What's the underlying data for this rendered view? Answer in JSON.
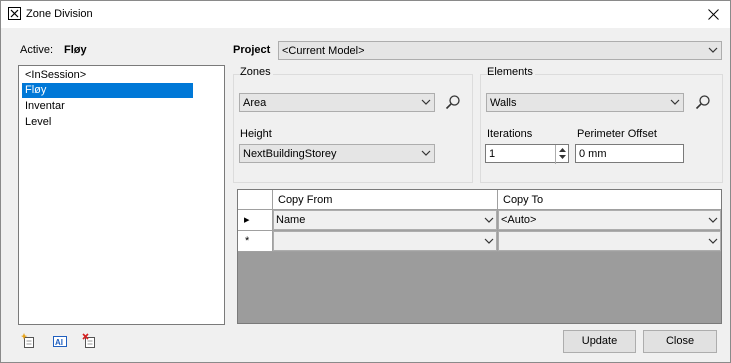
{
  "window": {
    "title": "Zone Division",
    "icon": "zone-division-icon"
  },
  "active": {
    "label": "Active:",
    "value": "Fløy"
  },
  "list": {
    "items": [
      {
        "label": "<InSession>"
      },
      {
        "label": "Fløy",
        "selected": true
      },
      {
        "label": "Inventar"
      },
      {
        "label": "Level"
      }
    ]
  },
  "project": {
    "label": "Project",
    "value": "<Current Model>"
  },
  "zones": {
    "group_label": "Zones",
    "type_value": "Area",
    "height_label": "Height",
    "height_value": "NextBuildingStorey"
  },
  "elements": {
    "group_label": "Elements",
    "type_value": "Walls",
    "iterations_label": "Iterations",
    "iterations_value": "1",
    "perimeter_label": "Perimeter Offset",
    "perimeter_value": "0 mm"
  },
  "grid": {
    "columns": [
      "Copy From",
      "Copy To"
    ],
    "rows": [
      {
        "indicator": "▸",
        "copy_from": "Name",
        "copy_to": "<Auto>"
      },
      {
        "indicator": "*",
        "copy_from": "",
        "copy_to": ""
      }
    ]
  },
  "toolbar": {
    "icons": [
      "new-item-icon",
      "rename-icon",
      "delete-item-icon"
    ]
  },
  "buttons": {
    "update": "Update",
    "close": "Close"
  },
  "colors": {
    "selection": "#0078d7",
    "grid_background": "#9c9c9c",
    "face": "#f0f0f0"
  }
}
